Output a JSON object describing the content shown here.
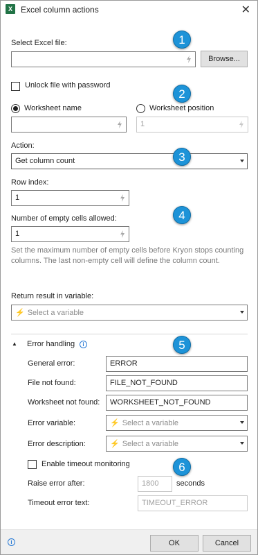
{
  "window": {
    "title": "Excel column actions",
    "app_icon": "X",
    "close": "✕"
  },
  "file": {
    "label": "Select Excel file:",
    "value": "",
    "browse_label": "Browse...",
    "unlock_label": "Unlock file with password",
    "unlock_checked": false
  },
  "worksheet": {
    "name_label": "Worksheet name",
    "position_label": "Worksheet position",
    "selected": "Worksheet name",
    "name_value": "",
    "position_value": "1"
  },
  "action": {
    "label": "Action:",
    "value": "Get column count"
  },
  "row_index": {
    "label": "Row index:",
    "value": "1"
  },
  "empty_cells": {
    "label": "Number of empty cells allowed:",
    "value": "1",
    "hint": "Set the maximum number of empty cells before Kryon stops counting columns. The last non-empty cell will define the column count."
  },
  "result": {
    "label": "Return result in variable:",
    "placeholder": "Select a variable"
  },
  "error_handling": {
    "title": "Error handling",
    "general_error_label": "General error:",
    "general_error_value": "ERROR",
    "file_not_found_label": "File not found:",
    "file_not_found_value": "FILE_NOT_FOUND",
    "worksheet_not_found_label": "Worksheet not found:",
    "worksheet_not_found_value": "WORKSHEET_NOT_FOUND",
    "error_variable_label": "Error variable:",
    "error_variable_placeholder": "Select a variable",
    "error_description_label": "Error description:",
    "error_description_placeholder": "Select a variable",
    "timeout_label": "Enable timeout monitoring",
    "timeout_checked": false,
    "raise_after_label": "Raise error after:",
    "raise_after_value": "1800",
    "seconds_label": "seconds",
    "timeout_text_label": "Timeout error text:",
    "timeout_text_value": "TIMEOUT_ERROR"
  },
  "badges": [
    "1",
    "2",
    "3",
    "4",
    "5",
    "6"
  ],
  "footer": {
    "ok_label": "OK",
    "cancel_label": "Cancel"
  },
  "colors": {
    "badge": "#1d93d8",
    "excel_green": "#217346",
    "variable_bolt": "#1e6fd0"
  }
}
